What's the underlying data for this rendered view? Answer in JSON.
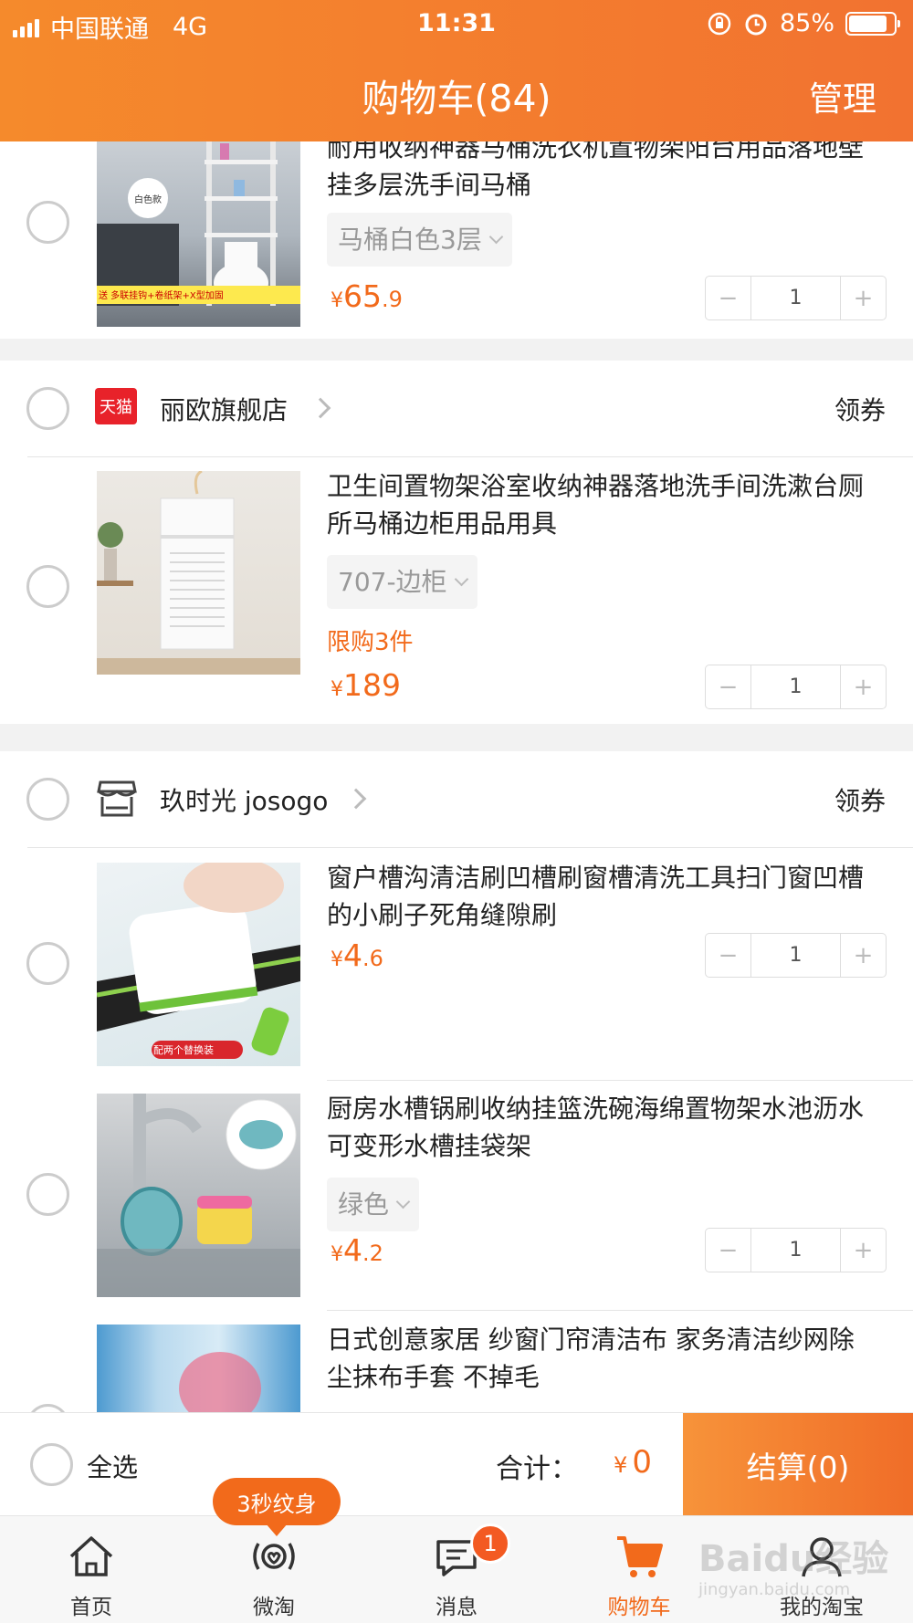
{
  "status_bar": {
    "carrier": "中国联通",
    "network": "4G",
    "time": "11:31",
    "battery": "85%"
  },
  "header": {
    "title": "购物车(84)",
    "manage": "管理"
  },
  "coupon_label": "领券",
  "items": [
    {
      "title": "耐用收纳神器马桶洗衣机置物架阳台用品落地壁挂多层洗手间马桶",
      "sku": "马桶白色3层",
      "price_int": "65",
      "price_dec": ".9",
      "qty": "1",
      "image_text": "白色款",
      "promo_text": "送 多联挂钩+卷纸架+X型加固"
    },
    {
      "title": "卫生间置物架浴室收纳神器落地洗手间洗漱台厕所马桶边柜用品用具",
      "sku": "707-边柜",
      "limit": "限购3件",
      "price_int": "189",
      "price_dec": "",
      "qty": "1"
    },
    {
      "title": "窗户槽沟清洁刷凹槽刷窗槽清洗工具扫门窗凹槽的小刷子死角缝隙刷",
      "price_int": "4",
      "price_dec": ".6",
      "qty": "1",
      "image_text": "配两个替换装"
    },
    {
      "title": "厨房水槽锅刷收纳挂篮洗碗海绵置物架水池沥水 可变形水槽挂袋架",
      "sku": "绿色",
      "price_int": "4",
      "price_dec": ".2",
      "qty": "1"
    },
    {
      "title": "日式创意家居 纱窗门帘清洁布 家务清洁纱网除尘抹布手套 不掉毛"
    }
  ],
  "shops": [
    {
      "name": "丽欧旗舰店",
      "logo": "天猫"
    },
    {
      "name": "玖时光 josogo"
    }
  ],
  "currency": "¥",
  "checkout": {
    "select_all": "全选",
    "total_label": "合计：",
    "total_int": "0",
    "button": "结算(0)"
  },
  "promo_bubble": "3秒纹身",
  "tabs": [
    {
      "label": "首页",
      "icon": "home-icon"
    },
    {
      "label": "微淘",
      "icon": "weitao-icon"
    },
    {
      "label": "消息",
      "icon": "message-icon",
      "badge": "1"
    },
    {
      "label": "购物车",
      "icon": "cart-icon"
    },
    {
      "label": "我的淘宝",
      "icon": "user-icon"
    }
  ],
  "watermark": {
    "brand": "Baidu经验",
    "url": "jingyan.baidu.com"
  },
  "colors": {
    "accent": "#f26a1b",
    "header_start": "#f58a2c",
    "header_end": "#f27230"
  }
}
